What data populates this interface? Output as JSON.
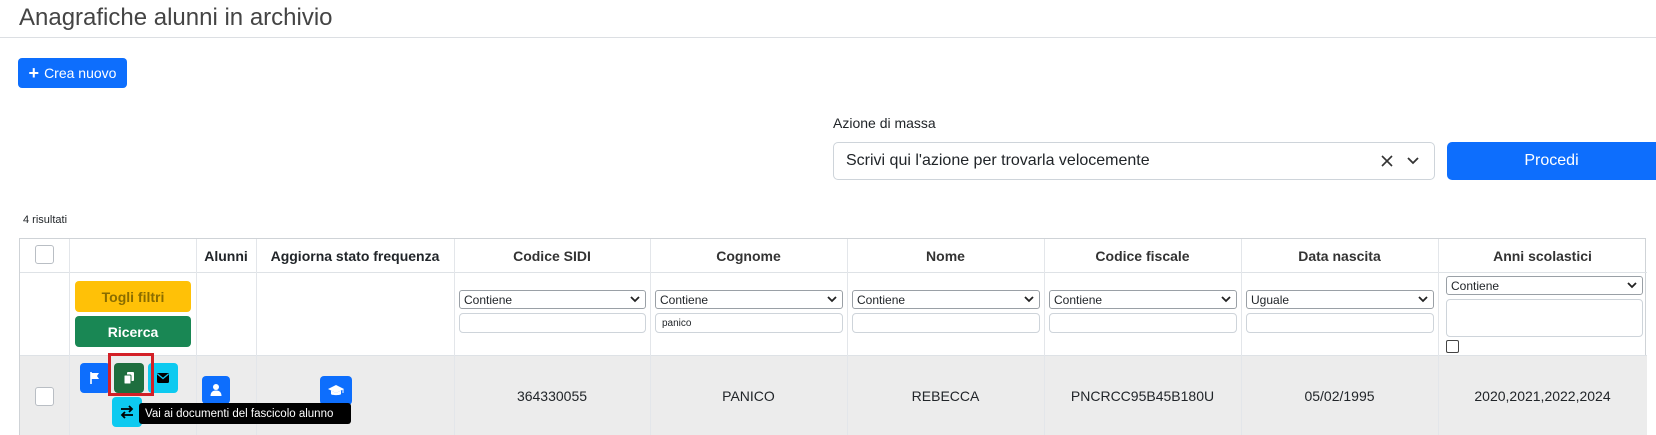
{
  "page": {
    "title": "Anagrafiche alunni in archivio",
    "new_button_label": "Crea nuovo",
    "new_button_icon": "plus-icon"
  },
  "mass_action": {
    "label": "Azione di massa",
    "placeholder": "Scrivi qui l'azione per trovarla velocemente",
    "submit_label": "Procedi"
  },
  "results_count": "4 risultati",
  "table": {
    "headers": {
      "alunni": "Alunni",
      "aggiorna": "Aggiorna stato frequenza",
      "codice_sidi": "Codice SIDI",
      "cognome": "Cognome",
      "nome": "Nome",
      "codice_fiscale": "Codice fiscale",
      "data_nascita": "Data nascita",
      "anni_scolastici": "Anni scolastici"
    },
    "filters": {
      "clear_label": "Togli filtri",
      "search_label": "Ricerca",
      "codice_sidi": {
        "mode": "Contiene",
        "value": ""
      },
      "cognome": {
        "mode": "Contiene",
        "value": "panico"
      },
      "nome": {
        "mode": "Contiene",
        "value": ""
      },
      "codice_fiscale": {
        "mode": "Contiene",
        "value": ""
      },
      "data_nascita": {
        "mode": "Uguale",
        "value": ""
      },
      "anni_scolastici": {
        "mode": "Contiene",
        "value": ""
      }
    },
    "rows": [
      {
        "codice_sidi": "364330055",
        "cognome": "PANICO",
        "nome": "REBECCA",
        "codice_fiscale": "PNCRCC95B45B180U",
        "data_nascita": "05/02/1995",
        "anni_scolastici": "2020,2021,2022,2024"
      }
    ]
  },
  "tooltip": "Vai ai documenti del fascicolo alunno",
  "colors": {
    "primary": "#0d6efd",
    "warning": "#ffc107",
    "success": "#198754",
    "info": "#0dcaf0",
    "highlight": "#d32027"
  }
}
